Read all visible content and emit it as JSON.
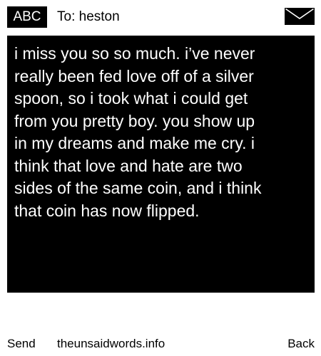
{
  "header": {
    "mode_label": "ABC",
    "recipient": "To: heston",
    "envelope_icon": "envelope-icon"
  },
  "message": {
    "text": "i miss you so so much. i’ve never\nreally been fed love off of a silver\nspoon, so i took what i could get\nfrom you pretty boy. you show up\nin my dreams and make me cry. i\nthink that love and hate are two\nsides of the same coin, and i think\nthat coin has now flipped."
  },
  "footer": {
    "send_label": "Send",
    "site_label": "theunsaidwords.info",
    "back_label": "Back"
  },
  "colors": {
    "background": "#ffffff",
    "message_bg": "#000000",
    "message_text": "#ffffff"
  }
}
